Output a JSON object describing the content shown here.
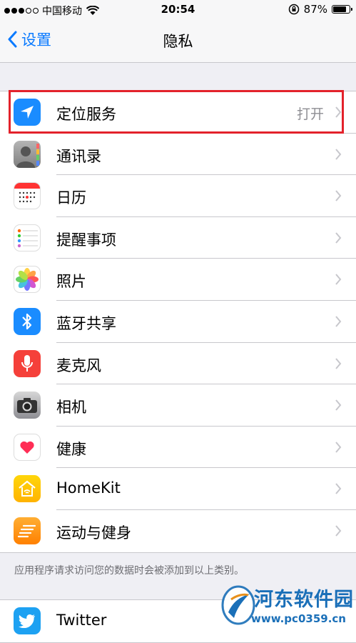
{
  "status_bar": {
    "carrier": "中国移动",
    "time": "20:54",
    "battery": "87%",
    "battery_level": 0.87
  },
  "nav": {
    "back_label": "设置",
    "title": "隐私"
  },
  "rows": [
    {
      "label": "定位服务",
      "value": "打开",
      "icon": "location-icon",
      "color": "#1a8cff"
    },
    {
      "label": "通讯录",
      "value": "",
      "icon": "contacts-icon",
      "color": "#9a9a9a"
    },
    {
      "label": "日历",
      "value": "",
      "icon": "calendar-icon",
      "color": "#ffffff"
    },
    {
      "label": "提醒事项",
      "value": "",
      "icon": "reminders-icon",
      "color": "#ffffff"
    },
    {
      "label": "照片",
      "value": "",
      "icon": "photos-icon",
      "color": "#ffffff"
    },
    {
      "label": "蓝牙共享",
      "value": "",
      "icon": "bluetooth-icon",
      "color": "#1a8cff"
    },
    {
      "label": "麦克风",
      "value": "",
      "icon": "microphone-icon",
      "color": "#f5403a"
    },
    {
      "label": "相机",
      "value": "",
      "icon": "camera-icon",
      "color": "#6d6d72"
    },
    {
      "label": "健康",
      "value": "",
      "icon": "health-icon",
      "color": "#ffffff"
    },
    {
      "label": "HomeKit",
      "value": "",
      "icon": "homekit-icon",
      "color": "#ffcc00"
    },
    {
      "label": "运动与健身",
      "value": "",
      "icon": "motion-icon",
      "color": "#ff9500"
    }
  ],
  "footnote": "应用程序请求访问您的数据时会被添加到以上类别。",
  "social_rows": [
    {
      "label": "Twitter",
      "icon": "twitter-icon",
      "color": "#1da1f2"
    }
  ],
  "watermark": {
    "title": "河东软件园",
    "url": "www.pc0359.cn"
  }
}
